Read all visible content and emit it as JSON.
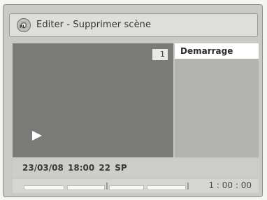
{
  "title": "Editer - Supprimer scène",
  "disc_label": "PL",
  "preview": {
    "scene_number": "1"
  },
  "menu": {
    "items": [
      {
        "label": "Demarrage",
        "selected": true
      },
      {
        "label": "",
        "selected": false
      },
      {
        "label": "",
        "selected": false
      }
    ]
  },
  "info": {
    "text": "23/03/08  18:00  22  SP"
  },
  "timeline": {
    "time": "1 : 00 : 00"
  },
  "icons": {
    "disc": "disc-icon",
    "play": "play-icon"
  }
}
